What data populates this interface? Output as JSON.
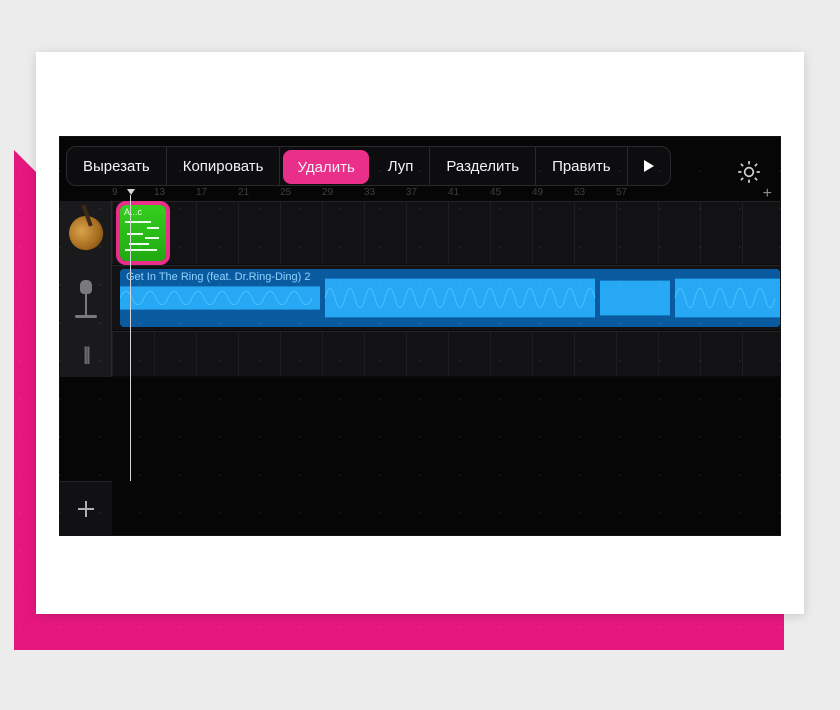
{
  "context_menu": {
    "items": [
      {
        "label": "Вырезать",
        "highlighted": false
      },
      {
        "label": "Копировать",
        "highlighted": false
      },
      {
        "label": "Удалить",
        "highlighted": true
      },
      {
        "label": "Луп",
        "highlighted": false
      },
      {
        "label": "Разделить",
        "highlighted": false
      },
      {
        "label": "Править",
        "highlighted": false
      }
    ],
    "more_arrow": "▶"
  },
  "ruler": {
    "ticks": [
      "9",
      "13",
      "17",
      "21",
      "25",
      "29",
      "33",
      "37",
      "41",
      "45",
      "49",
      "53",
      "57"
    ]
  },
  "tracks": {
    "guitar": {
      "clip_label": "A...c"
    },
    "audio": {
      "clip_title": "Get In The Ring (feat. Dr.Ring-Ding) 2"
    }
  },
  "colors": {
    "accent_pink": "#ea2f8a",
    "clip_green": "#28c216",
    "clip_blue_wave": "#1aa0f0"
  }
}
